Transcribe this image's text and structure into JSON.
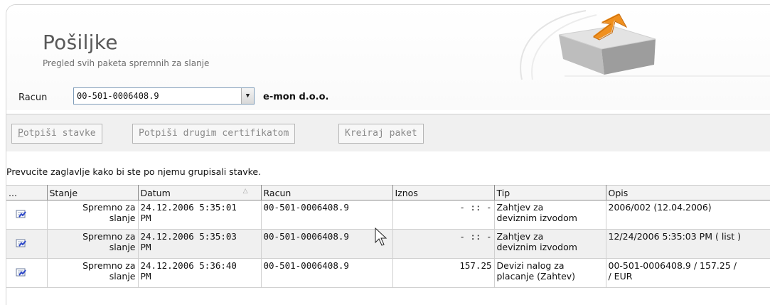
{
  "header": {
    "title": "Pošiljke",
    "subtitle": "Pregled svih paketa spremnih za slanje"
  },
  "account": {
    "label": "Racun",
    "selected": "00-501-0006408.9",
    "company": "e-mon d.o.o."
  },
  "toolbar": {
    "sign_items_accel": "P",
    "sign_items_rest": "otpiši stavke",
    "sign_other_cert": "Potpiši drugim certifikatom",
    "create_package": "Kreiraj paket"
  },
  "grid": {
    "group_hint": "Prevucite zaglavlje kako bi ste po njemu grupisali stavke.",
    "columns": {
      "menu": "...",
      "status": "Stanje",
      "date": "Datum",
      "account": "Racun",
      "amount": "Iznos",
      "type": "Tip",
      "description": "Opis"
    },
    "rows": [
      {
        "status_line1": "Spremno za",
        "status_line2": "slanje",
        "date_line1": "24.12.2006 5:35:01",
        "date_line2": "PM",
        "account": "00-501-0006408.9",
        "amount": "- :: -",
        "type_line1": "Zahtjev za",
        "type_line2": "deviznim izvodom",
        "desc_line1": "2006/002 (12.04.2006)",
        "desc_line2": ""
      },
      {
        "status_line1": "Spremno za",
        "status_line2": "slanje",
        "date_line1": "24.12.2006 5:35:03",
        "date_line2": "PM",
        "account": "00-501-0006408.9",
        "amount": "- :: -",
        "type_line1": "Zahtjev za",
        "type_line2": "deviznim izvodom",
        "desc_line1": "12/24/2006 5:35:03 PM ( list )",
        "desc_line2": ""
      },
      {
        "status_line1": "Spremno za",
        "status_line2": "slanje",
        "date_line1": "24.12.2006 5:36:40",
        "date_line2": "PM",
        "account": "00-501-0006408.9",
        "amount": "157.25",
        "type_line1": "Devizi nalog za",
        "type_line2": "placanje (Zahtev)",
        "desc_line1": "00-501-0006408.9 / 157.25 /",
        "desc_line2": "/ EUR"
      }
    ]
  },
  "icons": {
    "row_icon": "document-edit-icon",
    "hero": "package-upload-icon",
    "dropdown": "chevron-down-icon",
    "cursor": "mouse-pointer-icon"
  },
  "colors": {
    "hero_arrow": "#f0901e",
    "row_alt": "#f0f0f0",
    "toolbar_bg": "#f0f0f0"
  }
}
